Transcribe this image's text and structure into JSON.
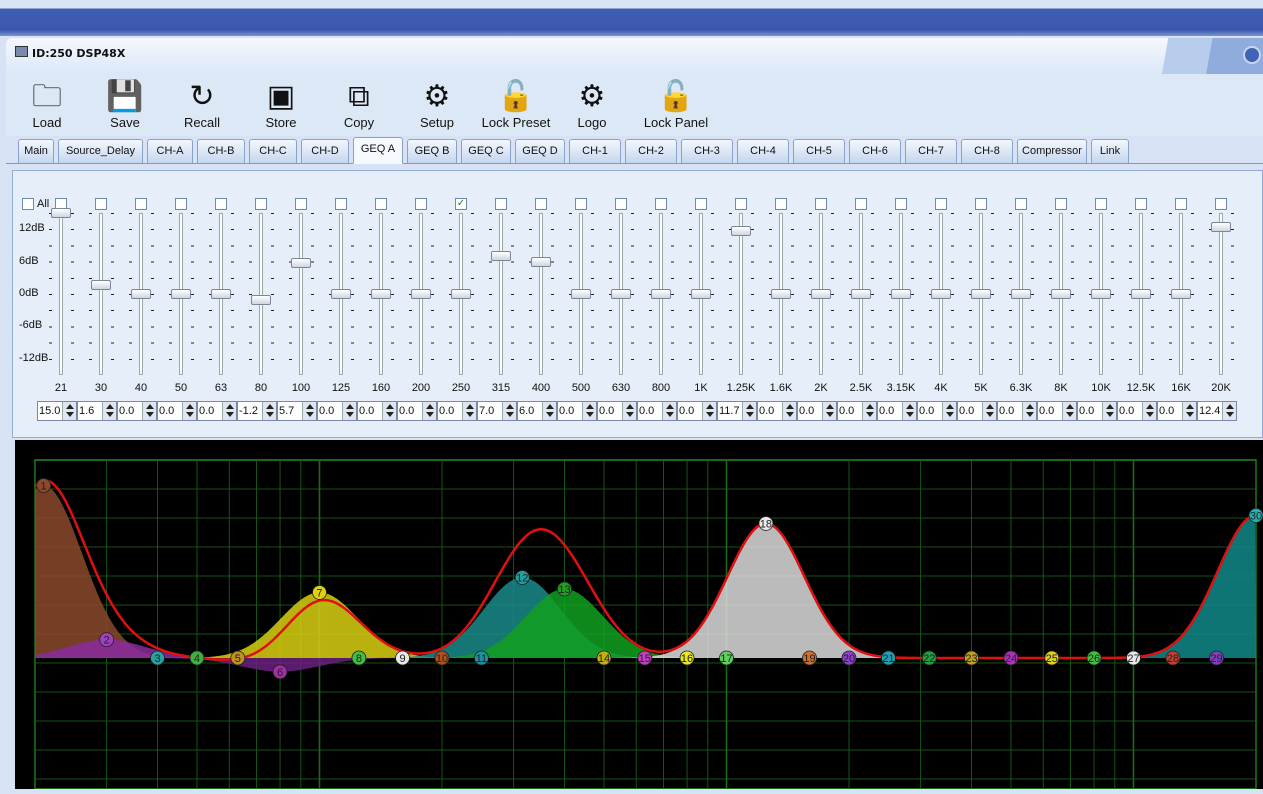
{
  "window": {
    "title": "ID:250   DSP48X"
  },
  "toolbar": [
    {
      "id": "load",
      "label": "Load",
      "icon": "folder-icon"
    },
    {
      "id": "save",
      "label": "Save",
      "icon": "floppy-icon"
    },
    {
      "id": "recall",
      "label": "Recall",
      "icon": "refresh-icon"
    },
    {
      "id": "store",
      "label": "Store",
      "icon": "chip-icon"
    },
    {
      "id": "copy",
      "label": "Copy",
      "icon": "copy-icon"
    },
    {
      "id": "setup",
      "label": "Setup",
      "icon": "gear-icon"
    },
    {
      "id": "lock-preset",
      "label": "Lock Preset",
      "icon": "lock-icon"
    },
    {
      "id": "logo",
      "label": "Logo",
      "icon": "gear-icon"
    },
    {
      "id": "lock-panel",
      "label": "Lock Panel",
      "icon": "lock-icon"
    }
  ],
  "tabs": [
    "Main",
    "Source_Delay",
    "CH-A",
    "CH-B",
    "CH-C",
    "CH-D",
    "GEQ A",
    "GEQ B",
    "GEQ C",
    "GEQ D",
    "CH-1",
    "CH-2",
    "CH-3",
    "CH-4",
    "CH-5",
    "CH-6",
    "CH-7",
    "CH-8",
    "Compressor",
    "Link"
  ],
  "active_tab": "GEQ A",
  "geq": {
    "all_label": "All",
    "db_labels": [
      "12dB",
      "6dB",
      "0dB",
      "-6dB",
      "-12dB"
    ],
    "range_db": [
      -15,
      15
    ],
    "bands": [
      {
        "freq": "21",
        "gain": "15.0",
        "checked": false
      },
      {
        "freq": "30",
        "gain": "1.6",
        "checked": false
      },
      {
        "freq": "40",
        "gain": "0.0",
        "checked": false
      },
      {
        "freq": "50",
        "gain": "0.0",
        "checked": false
      },
      {
        "freq": "63",
        "gain": "0.0",
        "checked": false
      },
      {
        "freq": "80",
        "gain": "-1.2",
        "checked": false
      },
      {
        "freq": "100",
        "gain": "5.7",
        "checked": false
      },
      {
        "freq": "125",
        "gain": "0.0",
        "checked": false
      },
      {
        "freq": "160",
        "gain": "0.0",
        "checked": false
      },
      {
        "freq": "200",
        "gain": "0.0",
        "checked": false
      },
      {
        "freq": "250",
        "gain": "0.0",
        "checked": true
      },
      {
        "freq": "315",
        "gain": "7.0",
        "checked": false
      },
      {
        "freq": "400",
        "gain": "6.0",
        "checked": false
      },
      {
        "freq": "500",
        "gain": "0.0",
        "checked": false
      },
      {
        "freq": "630",
        "gain": "0.0",
        "checked": false
      },
      {
        "freq": "800",
        "gain": "0.0",
        "checked": false
      },
      {
        "freq": "1K",
        "gain": "0.0",
        "checked": false
      },
      {
        "freq": "1.25K",
        "gain": "11.7",
        "checked": false
      },
      {
        "freq": "1.6K",
        "gain": "0.0",
        "checked": false
      },
      {
        "freq": "2K",
        "gain": "0.0",
        "checked": false
      },
      {
        "freq": "2.5K",
        "gain": "0.0",
        "checked": false
      },
      {
        "freq": "3.15K",
        "gain": "0.0",
        "checked": false
      },
      {
        "freq": "4K",
        "gain": "0.0",
        "checked": false
      },
      {
        "freq": "5K",
        "gain": "0.0",
        "checked": false
      },
      {
        "freq": "6.3K",
        "gain": "0.0",
        "checked": false
      },
      {
        "freq": "8K",
        "gain": "0.0",
        "checked": false
      },
      {
        "freq": "10K",
        "gain": "0.0",
        "checked": false
      },
      {
        "freq": "12.5K",
        "gain": "0.0",
        "checked": false
      },
      {
        "freq": "16K",
        "gain": "0.0",
        "checked": false
      },
      {
        "freq": "20K",
        "gain": "12.4",
        "checked": false
      }
    ]
  },
  "graph": {
    "marker_colors": [
      "#8b4a2b",
      "#a040c0",
      "#2aa0a0",
      "#40b040",
      "#c09020",
      "#a030a0",
      "#e0d010",
      "#40c040",
      "#e8e8e8",
      "#b05020",
      "#2090a0",
      "#20a0a0",
      "#20a020",
      "#c0b010",
      "#c040c0",
      "#e8e820",
      "#60d060",
      "#e8e8e8",
      "#d07030",
      "#9040d0",
      "#20a0b0",
      "#20a040",
      "#c0a020",
      "#b030c0",
      "#e0d020",
      "#40c040",
      "#e8e8e8",
      "#c04030",
      "#8040c0",
      "#20b0b0"
    ],
    "fill_colors": [
      "#8b4a2b",
      "#8a2aa0",
      "#207070",
      "#2a702a",
      "#706010",
      "#6a2080",
      "#d8d010",
      "#2a8a2a",
      "#d0d0d0",
      "#703010",
      "#1a7070",
      "#1a8a8a",
      "#10a020",
      "#808010",
      "#902090",
      "#b0b020",
      "#40a040",
      "#dcdcdc",
      "#904020",
      "#602090",
      "#208080",
      "#208030",
      "#806010",
      "#8020a0",
      "#b0a010",
      "#20a020",
      "#d0d0d0",
      "#903020",
      "#6020a0",
      "#108888"
    ],
    "curve_color": "#e01010"
  }
}
